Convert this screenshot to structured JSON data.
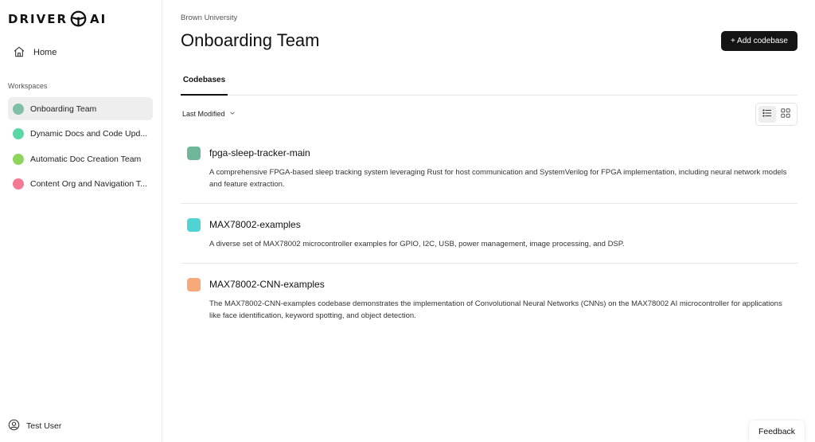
{
  "brand": {
    "name_left": "DRIVER",
    "name_right": "AI"
  },
  "sidebar": {
    "home_label": "Home",
    "workspaces_heading": "Workspaces",
    "workspaces": [
      {
        "label": "Onboarding Team",
        "color": "#7fbfa6",
        "active": true
      },
      {
        "label": "Dynamic Docs and Code Upd...",
        "color": "#5ad6a8",
        "active": false
      },
      {
        "label": "Automatic Doc Creation Team",
        "color": "#8fd45a",
        "active": false
      },
      {
        "label": "Content Org and Navigation T...",
        "color": "#f47a93",
        "active": false
      }
    ],
    "user_name": "Test User"
  },
  "header": {
    "breadcrumb": "Brown University",
    "title": "Onboarding Team",
    "add_button_label": "+ Add codebase"
  },
  "tabs": [
    {
      "label": "Codebases",
      "active": true
    }
  ],
  "sort": {
    "selected": "Last Modified"
  },
  "view_toggle": {
    "active": "list",
    "icons": [
      "list-view-icon",
      "grid-view-icon"
    ]
  },
  "codebases": [
    {
      "name": "fpga-sleep-tracker-main",
      "color": "#6fb69a",
      "description": "A comprehensive FPGA-based sleep tracking system leveraging Rust for host communication and SystemVerilog for FPGA implementation, including neural network models and feature extraction."
    },
    {
      "name": "MAX78002-examples",
      "color": "#4fd3d3",
      "description": "A diverse set of MAX78002 microcontroller examples for GPIO, I2C, USB, power management, image processing, and DSP."
    },
    {
      "name": "MAX78002-CNN-examples",
      "color": "#f7a97a",
      "description": "The MAX78002-CNN-examples codebase demonstrates the implementation of Convolutional Neural Networks (CNNs) on the MAX78002 AI microcontroller for applications like face identification, keyword spotting, and object detection."
    }
  ],
  "feedback_label": "Feedback"
}
